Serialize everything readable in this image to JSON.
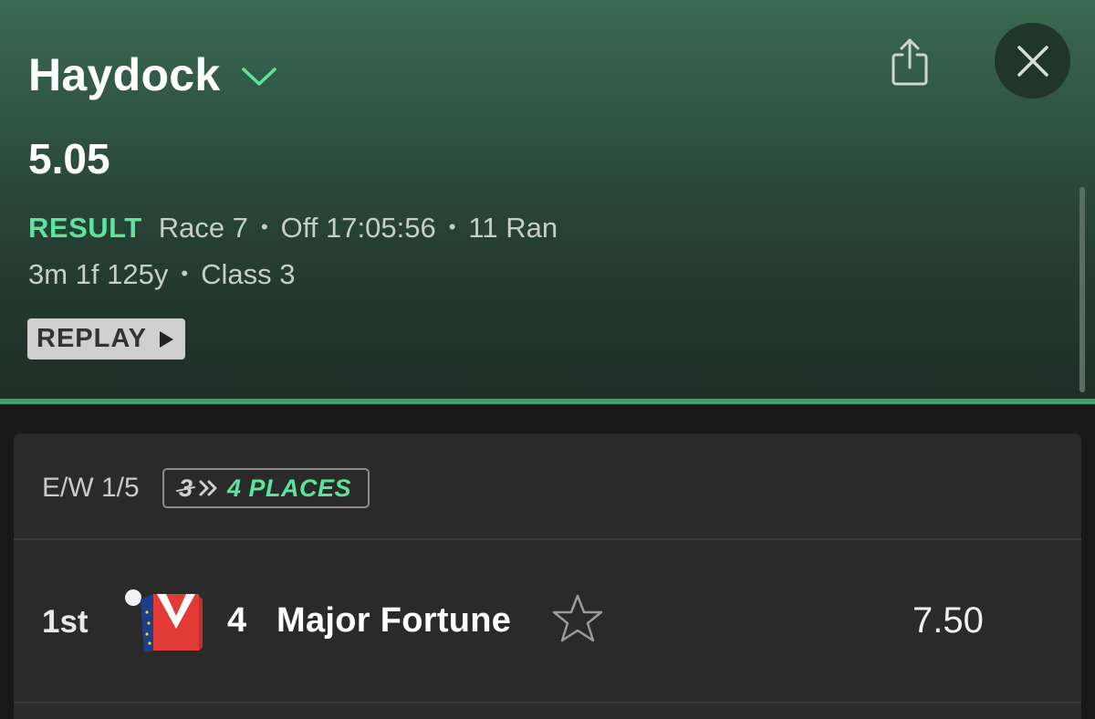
{
  "header": {
    "venue": "Haydock",
    "race_time": "5.05",
    "status": "RESULT",
    "race_number": "Race 7",
    "off_time": "Off 17:05:56",
    "runners": "11 Ran",
    "distance": "3m 1f 125y",
    "race_class": "Class 3",
    "replay_label": "REPLAY",
    "separator": "•"
  },
  "icons": {
    "venue_dropdown": "chevron-down-icon",
    "share": "share-icon",
    "close": "close-icon",
    "replay": "play-icon",
    "favourite": "star-outline-icon"
  },
  "market": {
    "each_way_terms": "E/W 1/5",
    "places_old": "3",
    "places_new": "4 PLACES"
  },
  "results": [
    {
      "position": "1st",
      "number": "4",
      "horse": "Major Fortune",
      "odds": "7.50",
      "silks": "red-white-chevron-blue-stars-sleeves"
    }
  ],
  "colors": {
    "accent_green": "#5de39b",
    "header_rule": "#3fa06d",
    "background": "#191919",
    "card": "#2a2a2a"
  }
}
